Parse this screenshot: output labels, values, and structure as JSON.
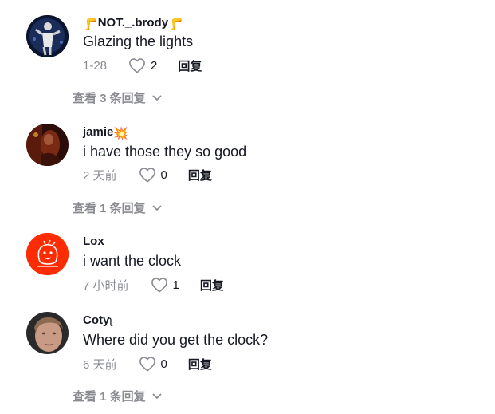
{
  "comments": [
    {
      "username_prefix": "🦵",
      "username": "NOT._.brody",
      "username_suffix": "🦵",
      "text": "Glazing the lights",
      "date": "1-28",
      "likes": "2",
      "reply_label": "回复",
      "view_replies": "查看 3 条回复"
    },
    {
      "username": "jamie",
      "username_suffix": "💥",
      "text": "i have those they so good",
      "date": "2 天前",
      "likes": "0",
      "reply_label": "回复",
      "view_replies": "查看 1 条回复"
    },
    {
      "username": "Lox",
      "text": "i want the clock",
      "date": "7 小时前",
      "likes": "1",
      "reply_label": "回复"
    },
    {
      "username": "Coty",
      "username_suffix": "ʅ",
      "text": "Where did you get the clock?",
      "date": "6 天前",
      "likes": "0",
      "reply_label": "回复",
      "view_replies": "查看 1 条回复"
    }
  ],
  "colors": {
    "text_primary": "#161823",
    "text_secondary": "#8a8b91",
    "lox_avatar": "#fe2c02"
  },
  "icons": {
    "like": "heart-outline-icon",
    "expand": "chevron-down-icon"
  }
}
